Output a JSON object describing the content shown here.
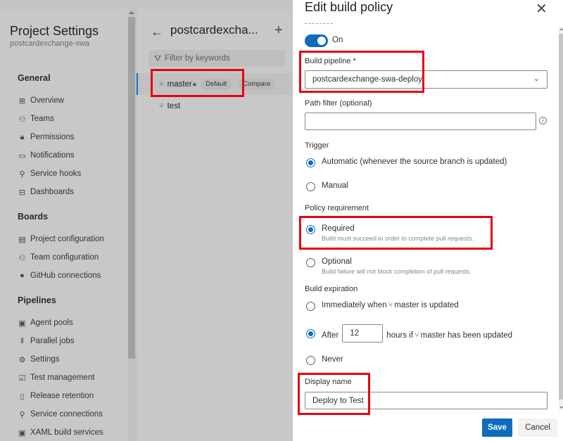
{
  "sidebar": {
    "title": "Project Settings",
    "subtitle": "postcardexchange-swa",
    "sections": [
      {
        "heading": "General",
        "items": [
          {
            "label": "Overview",
            "icon": "overview-icon",
            "glyph": "⊞"
          },
          {
            "label": "Teams",
            "icon": "teams-icon",
            "glyph": "⚇"
          },
          {
            "label": "Permissions",
            "icon": "lock-icon",
            "glyph": "🔒︎"
          },
          {
            "label": "Notifications",
            "icon": "notifications-icon",
            "glyph": "▭"
          },
          {
            "label": "Service hooks",
            "icon": "service-hooks-icon",
            "glyph": "⚲"
          },
          {
            "label": "Dashboards",
            "icon": "dashboards-icon",
            "glyph": "⊟"
          }
        ]
      },
      {
        "heading": "Boards",
        "items": [
          {
            "label": "Project configuration",
            "icon": "project-configuration-icon",
            "glyph": "▤"
          },
          {
            "label": "Team configuration",
            "icon": "team-configuration-icon",
            "glyph": "⚇"
          },
          {
            "label": "GitHub connections",
            "icon": "github-icon",
            "glyph": "●"
          }
        ]
      },
      {
        "heading": "Pipelines",
        "items": [
          {
            "label": "Agent pools",
            "icon": "agent-pools-icon",
            "glyph": "▣"
          },
          {
            "label": "Parallel jobs",
            "icon": "parallel-jobs-icon",
            "glyph": "‖"
          },
          {
            "label": "Settings",
            "icon": "gear-icon",
            "glyph": "⚙"
          },
          {
            "label": "Test management",
            "icon": "test-management-icon",
            "glyph": "☑"
          },
          {
            "label": "Release retention",
            "icon": "release-retention-icon",
            "glyph": "▯"
          },
          {
            "label": "Service connections",
            "icon": "service-connections-icon",
            "glyph": "⚲"
          },
          {
            "label": "XAML build services",
            "icon": "xaml-build-icon",
            "glyph": "▣"
          }
        ]
      }
    ]
  },
  "branches": {
    "repo_title": "postcardexcha...",
    "back_glyph": "←",
    "add_glyph": "+",
    "filter_placeholder": "Filter by keywords",
    "filter_glyph": "⛛",
    "branch_glyph": "⑂",
    "lock_glyph": "🔒︎",
    "items": [
      {
        "name": "master",
        "locked": true,
        "default_badge": "Default",
        "compare_label": "Compare",
        "selected": true
      },
      {
        "name": "test",
        "selected": false
      }
    ]
  },
  "panel": {
    "title": "Edit build policy",
    "close_glyph": "✕",
    "enabled": {
      "state": true,
      "label": "On"
    },
    "build_pipeline": {
      "label": "Build pipeline *",
      "value": "postcardexchange-swa-deploy",
      "chevron": "⌄"
    },
    "path_filter": {
      "label": "Path filter (optional)",
      "value": "",
      "info_glyph": "i"
    },
    "trigger": {
      "label": "Trigger",
      "options": [
        {
          "label": "Automatic (whenever the source branch is updated)",
          "selected": true
        },
        {
          "label": "Manual",
          "selected": false
        }
      ]
    },
    "policy_requirement": {
      "label": "Policy requirement",
      "options": [
        {
          "label": "Required",
          "description": "Build must succeed in order to complete pull requests.",
          "selected": true
        },
        {
          "label": "Optional",
          "description": "Build failure will not block completion of pull requests.",
          "selected": false
        }
      ]
    },
    "build_expiration": {
      "label": "Build expiration",
      "immediately_prefix": "Immediately when",
      "immediately_suffix": "master is updated",
      "after_prefix": "After",
      "after_hours": "12",
      "after_suffix_a": "hours if",
      "after_suffix_b": "master has been updated",
      "never_label": "Never",
      "selected": "after"
    },
    "display_name": {
      "label": "Display name",
      "value": "Deploy to Test"
    },
    "save_label": "Save",
    "cancel_label": "Cancel"
  },
  "colors": {
    "accent": "#0f6cbd",
    "highlight": "#e8000d",
    "overlay": "#c8c8c8"
  }
}
